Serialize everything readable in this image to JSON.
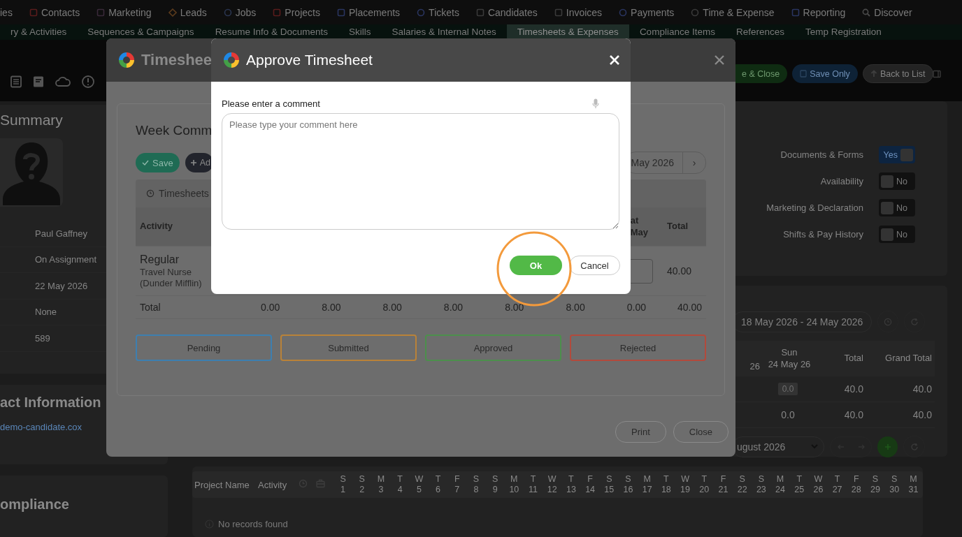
{
  "nav": {
    "items": [
      {
        "label": "ies"
      },
      {
        "label": "Contacts"
      },
      {
        "label": "Marketing"
      },
      {
        "label": "Leads"
      },
      {
        "label": "Jobs"
      },
      {
        "label": "Projects"
      },
      {
        "label": "Placements"
      },
      {
        "label": "Tickets"
      },
      {
        "label": "Candidates"
      },
      {
        "label": "Invoices"
      },
      {
        "label": "Payments"
      },
      {
        "label": "Time & Expense"
      },
      {
        "label": "Reporting"
      },
      {
        "label": "Discover",
        "kind": "search"
      }
    ]
  },
  "record_tabs": [
    {
      "label": "ry & Activities",
      "selected": false
    },
    {
      "label": "Sequences & Campaigns",
      "selected": false
    },
    {
      "label": "Resume Info & Documents",
      "selected": false
    },
    {
      "label": "Skills",
      "selected": false
    },
    {
      "label": "Salaries & Internal Notes",
      "selected": false
    },
    {
      "label": "Timesheets & Expenses",
      "selected": true
    },
    {
      "label": "Compliance Items",
      "selected": false
    },
    {
      "label": "References",
      "selected": false
    },
    {
      "label": "Temp Registration",
      "selected": false
    }
  ],
  "toolbar": {
    "buttons": [
      {
        "label": "e & Close",
        "kind": "success"
      },
      {
        "label": "Save Only",
        "kind": "primary"
      },
      {
        "label": "Back to List",
        "kind": "secondary"
      }
    ]
  },
  "summary": {
    "title": "Summary",
    "fields": [
      "Paul Gaffney",
      "On Assignment",
      "22 May 2026",
      "None",
      "589"
    ]
  },
  "contact": {
    "title": "act Information",
    "email": "demo-candidate.cox"
  },
  "compliance": {
    "title": "ompliance"
  },
  "permissions": {
    "toggles": [
      {
        "label": "Documents & Forms",
        "on": true,
        "text": "Yes"
      },
      {
        "label": "Availability",
        "on": false,
        "text": "No"
      },
      {
        "label": "Marketing & Declaration",
        "on": false,
        "text": "No"
      },
      {
        "label": "Shifts & Pay History",
        "on": false,
        "text": "No"
      }
    ]
  },
  "week_summary": {
    "date_range": "18 May 2026 - 24 May 2026",
    "columns": [
      {
        "lines": [
          "26"
        ]
      },
      {
        "lines": [
          "Sun",
          "24 May 26"
        ]
      },
      {
        "lines": [
          "Total"
        ]
      },
      {
        "lines": [
          "Grand Total"
        ]
      }
    ],
    "rows": [
      {
        "kind": "entry",
        "cells": [
          "",
          "0.0",
          "40.0",
          "40.0"
        ]
      },
      {
        "kind": "total",
        "cells": [
          "",
          "0.0",
          "40.0",
          "40.0"
        ]
      }
    ],
    "month": "ugust 2026"
  },
  "calendar": {
    "columns": [
      "Project Name",
      "Activity"
    ],
    "days": [
      {
        "weekday": "S",
        "date": "1"
      },
      {
        "weekday": "S",
        "date": "2"
      },
      {
        "weekday": "M",
        "date": "3"
      },
      {
        "weekday": "T",
        "date": "4"
      },
      {
        "weekday": "W",
        "date": "5"
      },
      {
        "weekday": "T",
        "date": "6"
      },
      {
        "weekday": "F",
        "date": "7"
      },
      {
        "weekday": "S",
        "date": "8"
      },
      {
        "weekday": "S",
        "date": "9"
      },
      {
        "weekday": "M",
        "date": "10"
      },
      {
        "weekday": "T",
        "date": "11"
      },
      {
        "weekday": "W",
        "date": "12"
      },
      {
        "weekday": "T",
        "date": "13"
      },
      {
        "weekday": "F",
        "date": "14"
      },
      {
        "weekday": "S",
        "date": "15"
      },
      {
        "weekday": "S",
        "date": "16"
      },
      {
        "weekday": "M",
        "date": "17"
      },
      {
        "weekday": "T",
        "date": "18"
      },
      {
        "weekday": "W",
        "date": "19"
      },
      {
        "weekday": "T",
        "date": "20"
      },
      {
        "weekday": "F",
        "date": "21"
      },
      {
        "weekday": "S",
        "date": "22"
      },
      {
        "weekday": "S",
        "date": "23"
      },
      {
        "weekday": "M",
        "date": "24"
      },
      {
        "weekday": "T",
        "date": "25"
      },
      {
        "weekday": "W",
        "date": "26"
      },
      {
        "weekday": "T",
        "date": "27"
      },
      {
        "weekday": "F",
        "date": "28"
      },
      {
        "weekday": "S",
        "date": "29"
      },
      {
        "weekday": "S",
        "date": "30"
      },
      {
        "weekday": "M",
        "date": "31"
      }
    ],
    "empty_text": "No records found"
  },
  "timesheet_modal": {
    "title": "Timeshee",
    "card_title": "Week Comm",
    "buttons": [
      {
        "label": "Save",
        "kind": "save"
      },
      {
        "label": "Ad",
        "kind": "add"
      }
    ],
    "period": "May 2026",
    "next": "›",
    "tab": "Timesheets",
    "table": {
      "columns": [
        {
          "lines": [
            "Activity"
          ]
        },
        {
          "lines": [
            "at",
            "May"
          ]
        },
        {
          "lines": [
            "Total"
          ]
        }
      ],
      "rows": [
        {
          "activity": "Regular",
          "detail": "Travel Nurse (Dunder Mifflin)",
          "total": "40.00"
        }
      ],
      "totals": {
        "label": "Total",
        "values": [
          "0.00",
          "8.00",
          "8.00",
          "8.00",
          "8.00",
          "8.00",
          "0.00",
          "40.00"
        ]
      }
    },
    "statuses": [
      {
        "label": "Pending",
        "color": "#3d7fb0"
      },
      {
        "label": "Submitted",
        "color": "#b98238"
      },
      {
        "label": "Approved",
        "color": "#4c8f4c"
      },
      {
        "label": "Rejected",
        "color": "#b24a3c"
      }
    ],
    "footer_buttons": [
      "Print",
      "Close"
    ]
  },
  "approve_dialog": {
    "title": "Approve Timesheet",
    "prompt": "Please enter a comment",
    "placeholder": "Please type your comment here",
    "buttons": [
      {
        "label": "Ok",
        "kind": "primary"
      },
      {
        "label": "Cancel",
        "kind": "secondary"
      }
    ]
  }
}
